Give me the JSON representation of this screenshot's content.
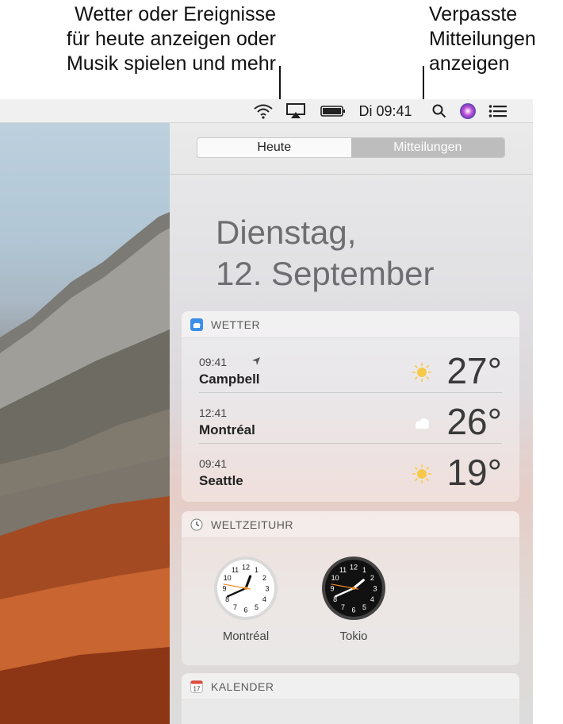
{
  "callouts": {
    "left": [
      "Wetter oder Ereignisse",
      "für heute anzeigen oder",
      "Musik spielen und mehr"
    ],
    "right": [
      "Verpasste",
      "Mitteilungen",
      "anzeigen"
    ]
  },
  "menubar": {
    "clock": "Di 09:41",
    "icons": [
      "wifi-icon",
      "airplay-icon",
      "battery-icon",
      "search-icon",
      "siri-icon",
      "notification-center-icon"
    ]
  },
  "tabs": {
    "today": "Heute",
    "notifications": "Mitteilungen"
  },
  "date": {
    "weekday": "Dienstag,",
    "day": "12. September"
  },
  "weather": {
    "title": "WETTER",
    "rows": [
      {
        "time": "09:41",
        "city": "Campbell",
        "temp": "27°",
        "icon": "sun-icon",
        "location_arrow": true
      },
      {
        "time": "12:41",
        "city": "Montréal",
        "temp": "26°",
        "icon": "cloud-icon"
      },
      {
        "time": "09:41",
        "city": "Seattle",
        "temp": "19°",
        "icon": "sun-icon"
      }
    ]
  },
  "worldclock": {
    "title": "WELTZEITUHR",
    "clocks": [
      {
        "city": "Montréal",
        "style": "light",
        "hour": 12,
        "minute": 41
      },
      {
        "city": "Tokio",
        "style": "dark",
        "hour": 1,
        "minute": 41
      }
    ]
  },
  "calendar": {
    "title": "KALENDER",
    "icon_day": "17"
  },
  "colors": {
    "accent_orange": "#f08a24",
    "sun": "#f7c948",
    "weather_icon": "#3b8fe8"
  }
}
